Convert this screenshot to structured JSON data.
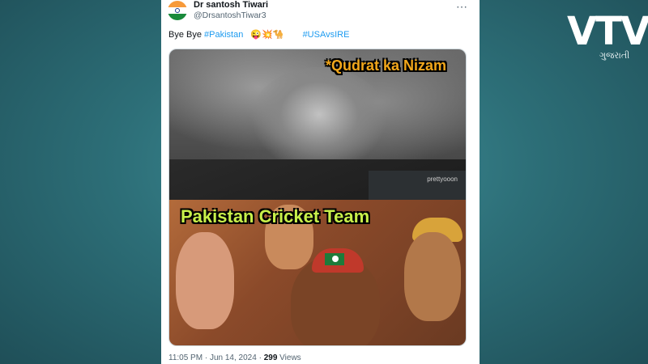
{
  "tweet": {
    "author_name": "Dr santosh Tiwari",
    "handle": "@DrsantoshTiwar3",
    "more_icon": "⋯",
    "text_prefix": "Bye Bye",
    "hashtag_1": "#Pakistan",
    "emojis": "😜💥🐪",
    "hashtag_2": "#USAvsIRE",
    "time": "11:05 PM",
    "date": "Jun 14, 2024",
    "separator": "·",
    "views_count": "299",
    "views_label": "Views"
  },
  "meme": {
    "top_caption": "*Qudrat ka Nizam",
    "bottom_caption": "Pakistan Cricket Team",
    "watermark": "prettyooon"
  },
  "brand": {
    "logo": "VTV",
    "sub": "ગુજરાતી"
  },
  "colors": {
    "link": "#1d9bf0",
    "top_caption": "#f2a71b",
    "bottom_caption": "#c8f04a",
    "background": "#2d6f78"
  }
}
